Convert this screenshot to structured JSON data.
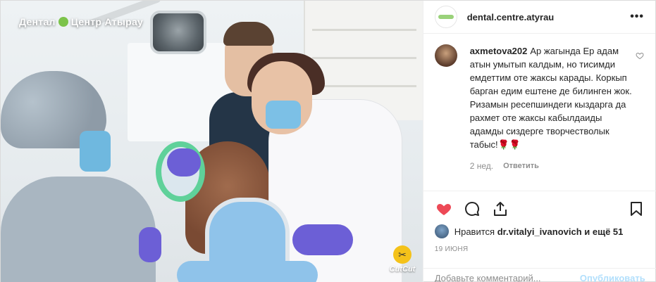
{
  "photo": {
    "watermark_left": "Дентал",
    "watermark_right": "Центр Атырау",
    "editor_badge_icon": "scissors-icon",
    "editor_name": "CutCut"
  },
  "header": {
    "username": "dental.centre.atyrau",
    "more_label": "•••"
  },
  "comment": {
    "username": "axmetova202",
    "text": "Ар жагында Ер адам атын умытып калдым, но тисимди емдеттим оте жаксы карады. Коркып барган едим ештене де билинген жок. Ризамын ресепшиндеги кыздарга да рахмет оте жаксы кабылдаиды адамды сиздерге творчестволык табыс!🌹🌹",
    "time": "2 нед.",
    "reply_label": "Ответить"
  },
  "actions": {
    "like_icon": "heart-icon",
    "comment_icon": "comment-bubble-icon",
    "share_icon": "share-icon",
    "save_icon": "bookmark-icon",
    "like_color": "#ed4956"
  },
  "likes": {
    "prefix": "Нравится",
    "user": "dr.vitalyi_ivanovich",
    "suffix": "и ещё 51"
  },
  "date": "19 июня",
  "add_comment": {
    "placeholder": "Добавьте комментарий...",
    "publish_label": "Опубликовать"
  }
}
